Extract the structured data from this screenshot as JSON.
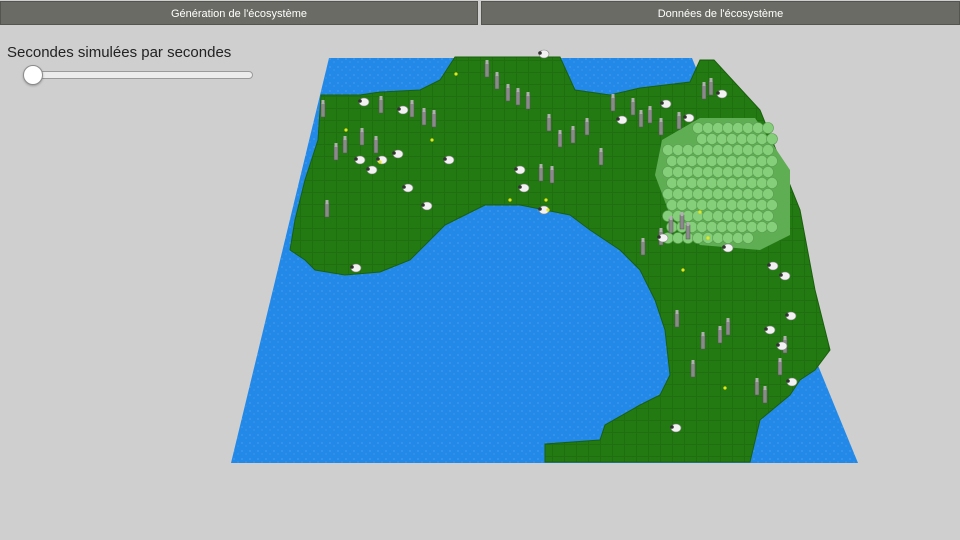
{
  "toolbar": {
    "generation_label": "Génération de l'écosystème",
    "data_label": "Données de l'écosystème"
  },
  "speed": {
    "label": "Secondes simulées par secondes",
    "value_fraction": 0.0
  },
  "colors": {
    "background": "#cfcfcf",
    "water": "#2389e8",
    "grass": "#237a12",
    "grass_dark": "#1c6a0e",
    "tree": "#7fc774",
    "wolf": "#8a8a8a",
    "sheep": "#f2f2f2",
    "plant": "#e6e61a"
  },
  "scene": {
    "entities": [
      "wolf",
      "sheep",
      "forest",
      "plant"
    ]
  }
}
